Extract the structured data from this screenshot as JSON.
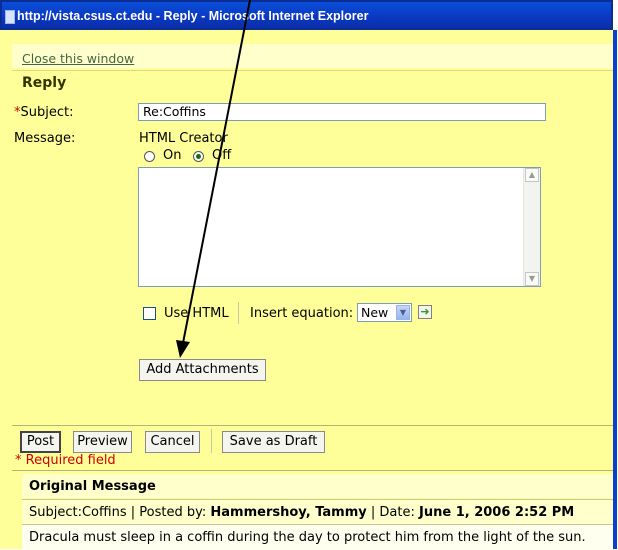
{
  "window": {
    "title": "http://vista.csus.ct.edu - Reply - Microsoft Internet Explorer"
  },
  "page": {
    "close_link": "Close this window",
    "heading": "Reply"
  },
  "form": {
    "subject_asterisk": "*",
    "subject_label": "Subject:",
    "subject_value": "Re:Coffins",
    "message_label": "Message:",
    "html_creator_label": "HTML Creator",
    "radio_on_label": "On",
    "radio_off_label": "Off",
    "selected_mode": "Off",
    "message_value": "",
    "use_html_label": "Use HTML",
    "use_html_checked": false,
    "insert_equation_label": "Insert equation:",
    "equation_selected": "New",
    "add_attachments_label": "Add Attachments"
  },
  "actions": {
    "post": "Post",
    "preview": "Preview",
    "cancel": "Cancel",
    "save_draft": "Save as Draft",
    "required_asterisk": "*",
    "required_note": "Required field"
  },
  "original_message": {
    "heading": "Original Message",
    "subject_label": "Subject:",
    "subject": "Coffins",
    "separator": "|",
    "posted_by_label": "Posted by:",
    "posted_by": "Hammershoy, Tammy",
    "date_label": "Date:",
    "date": "June 1, 2006 2:52 PM",
    "body": "Dracula must sleep in a coffin during the day to protect him from the light of the sun."
  },
  "colors": {
    "page_background": "#ffff99",
    "titlebar": "#0b39c4",
    "required": "#cc0000"
  }
}
